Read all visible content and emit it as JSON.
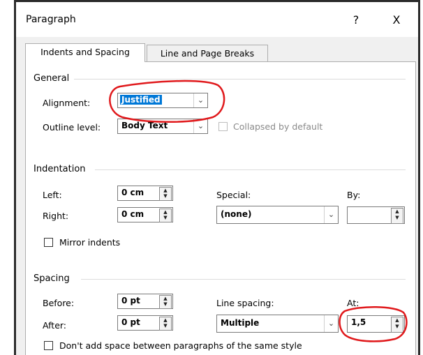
{
  "dialog": {
    "title": "Paragraph",
    "help_button": "?",
    "close_button": "X"
  },
  "tabs": [
    {
      "label": "Indents and Spacing",
      "active": true
    },
    {
      "label": "Line and Page Breaks",
      "active": false
    }
  ],
  "general": {
    "section_label": "General",
    "alignment_label": "Alignment:",
    "alignment_value": "Justified",
    "outline_level_label": "Outline level:",
    "outline_level_value": "Body Text",
    "collapsed_label": "Collapsed by default"
  },
  "indentation": {
    "section_label": "Indentation",
    "left_label": "Left:",
    "left_value": "0 cm",
    "right_label": "Right:",
    "right_value": "0 cm",
    "special_label": "Special:",
    "special_value": "(none)",
    "by_label": "By:",
    "by_value": "",
    "mirror_label": "Mirror indents"
  },
  "spacing": {
    "section_label": "Spacing",
    "before_label": "Before:",
    "before_value": "0 pt",
    "after_label": "After:",
    "after_value": "0 pt",
    "line_spacing_label": "Line spacing:",
    "line_spacing_value": "Multiple",
    "at_label": "At:",
    "at_value": "1,5",
    "dont_add_space_label": "Don't add space between paragraphs of the same style"
  },
  "icons": {
    "dropdown": "chevron-down-icon",
    "spinner": "spin-up-down-icon",
    "annotation": "red-circle-annotation"
  },
  "colors": {
    "selection": "#0078d7",
    "annotation": "#e0181b",
    "dialog_bg": "#f0f0f0"
  }
}
